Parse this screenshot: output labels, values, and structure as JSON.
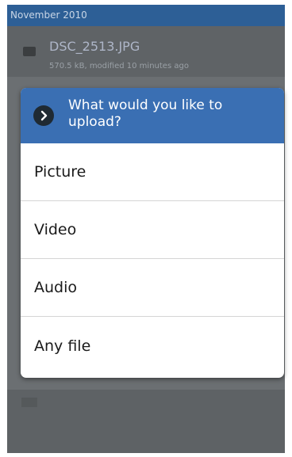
{
  "background": {
    "section_header": "November 2010",
    "file_item": {
      "name": "DSC_2513.JPG",
      "meta": "570.5 kB, modified 10 minutes ago"
    }
  },
  "dialog": {
    "title": "What would you like to upload?",
    "title_icon": "chevron-right-icon",
    "options": [
      {
        "label": "Picture"
      },
      {
        "label": "Video"
      },
      {
        "label": "Audio"
      },
      {
        "label": "Any file"
      }
    ]
  },
  "colors": {
    "dialog_title_bg": "#3a6fb3",
    "section_header_bg": "#2d5f96",
    "screen_dim": "#6b6f72"
  }
}
